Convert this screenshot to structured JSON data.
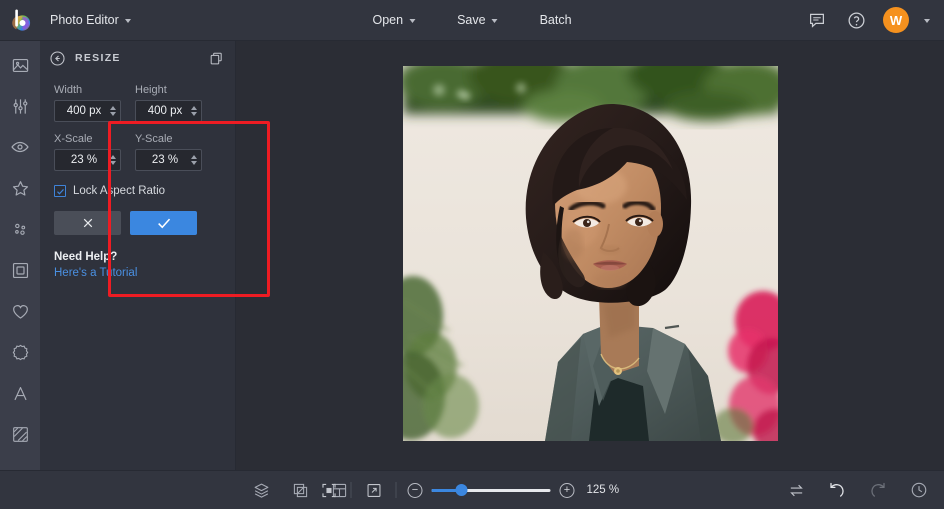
{
  "app": {
    "brand_label": "Photo Editor",
    "logo_icon": "befunky-b-colorwheel-logo"
  },
  "topbar": {
    "menus": [
      {
        "label": "Open",
        "icon": "chevron-down-icon",
        "has_chevron": true
      },
      {
        "label": "Save",
        "icon": "chevron-down-icon",
        "has_chevron": true
      },
      {
        "label": "Batch",
        "has_chevron": false
      }
    ],
    "right_icons": [
      {
        "name": "chat-icon",
        "title": "Chat"
      },
      {
        "name": "help-icon",
        "title": "Help"
      }
    ],
    "avatar_initial": "W",
    "avatar_color": "#f5911e",
    "account_chevron": "chevron-down-icon"
  },
  "rail": {
    "items": [
      {
        "name": "sidebar-item-edit",
        "icon": "image-icon"
      },
      {
        "name": "sidebar-item-adjust",
        "icon": "sliders-icon"
      },
      {
        "name": "sidebar-item-retouch",
        "icon": "eye-icon"
      },
      {
        "name": "sidebar-item-effects",
        "icon": "star-icon"
      },
      {
        "name": "sidebar-item-artsy",
        "icon": "dots-icon"
      },
      {
        "name": "sidebar-item-frames",
        "icon": "square-frame-icon"
      },
      {
        "name": "sidebar-item-overlays",
        "icon": "heart-icon"
      },
      {
        "name": "sidebar-item-graphics",
        "icon": "badge-icon"
      },
      {
        "name": "sidebar-item-text",
        "icon": "text-a-icon"
      },
      {
        "name": "sidebar-item-textures",
        "icon": "texture-icon"
      }
    ]
  },
  "panel": {
    "title": "RESIZE",
    "back_icon": "back-arrow-icon",
    "duplicate_icon": "duplicate-icon",
    "fields": {
      "width": {
        "label": "Width",
        "value": "400 px"
      },
      "height": {
        "label": "Height",
        "value": "400 px"
      },
      "x_scale": {
        "label": "X-Scale",
        "value": "23 %"
      },
      "y_scale": {
        "label": "Y-Scale",
        "value": "23 %"
      }
    },
    "lock": {
      "label": "Lock Aspect Ratio",
      "checked": true
    },
    "buttons": {
      "cancel_icon": "close-x-icon",
      "apply_icon": "checkmark-icon",
      "apply_color": "#3b87e0"
    },
    "help": {
      "title": "Need Help?",
      "link": "Here's a Tutorial",
      "link_color": "#4a90e2"
    },
    "highlight_color": "#ee1c23"
  },
  "canvas": {
    "image_alt": "Portrait of a young woman in a grey blazer in front of a beige wall with green foliage and pink flowers"
  },
  "bottombar": {
    "left_icons": [
      {
        "name": "layers-icon"
      },
      {
        "name": "crop-transform-icon"
      },
      {
        "name": "layout-grid-icon"
      }
    ],
    "view_icons": [
      {
        "name": "fit-to-screen-icon"
      },
      {
        "name": "expand-fullscreen-icon"
      }
    ],
    "zoom_out_icon": "minus-icon",
    "zoom_in_icon": "plus-icon",
    "zoom_value": "125 %",
    "slider_percent": 25,
    "slider_color": "#3b87e0",
    "right_icons": [
      {
        "name": "compare-swap-icon",
        "enabled": true
      },
      {
        "name": "undo-icon",
        "enabled": true
      },
      {
        "name": "redo-icon",
        "enabled": false
      },
      {
        "name": "history-clock-icon",
        "enabled": true
      }
    ]
  }
}
